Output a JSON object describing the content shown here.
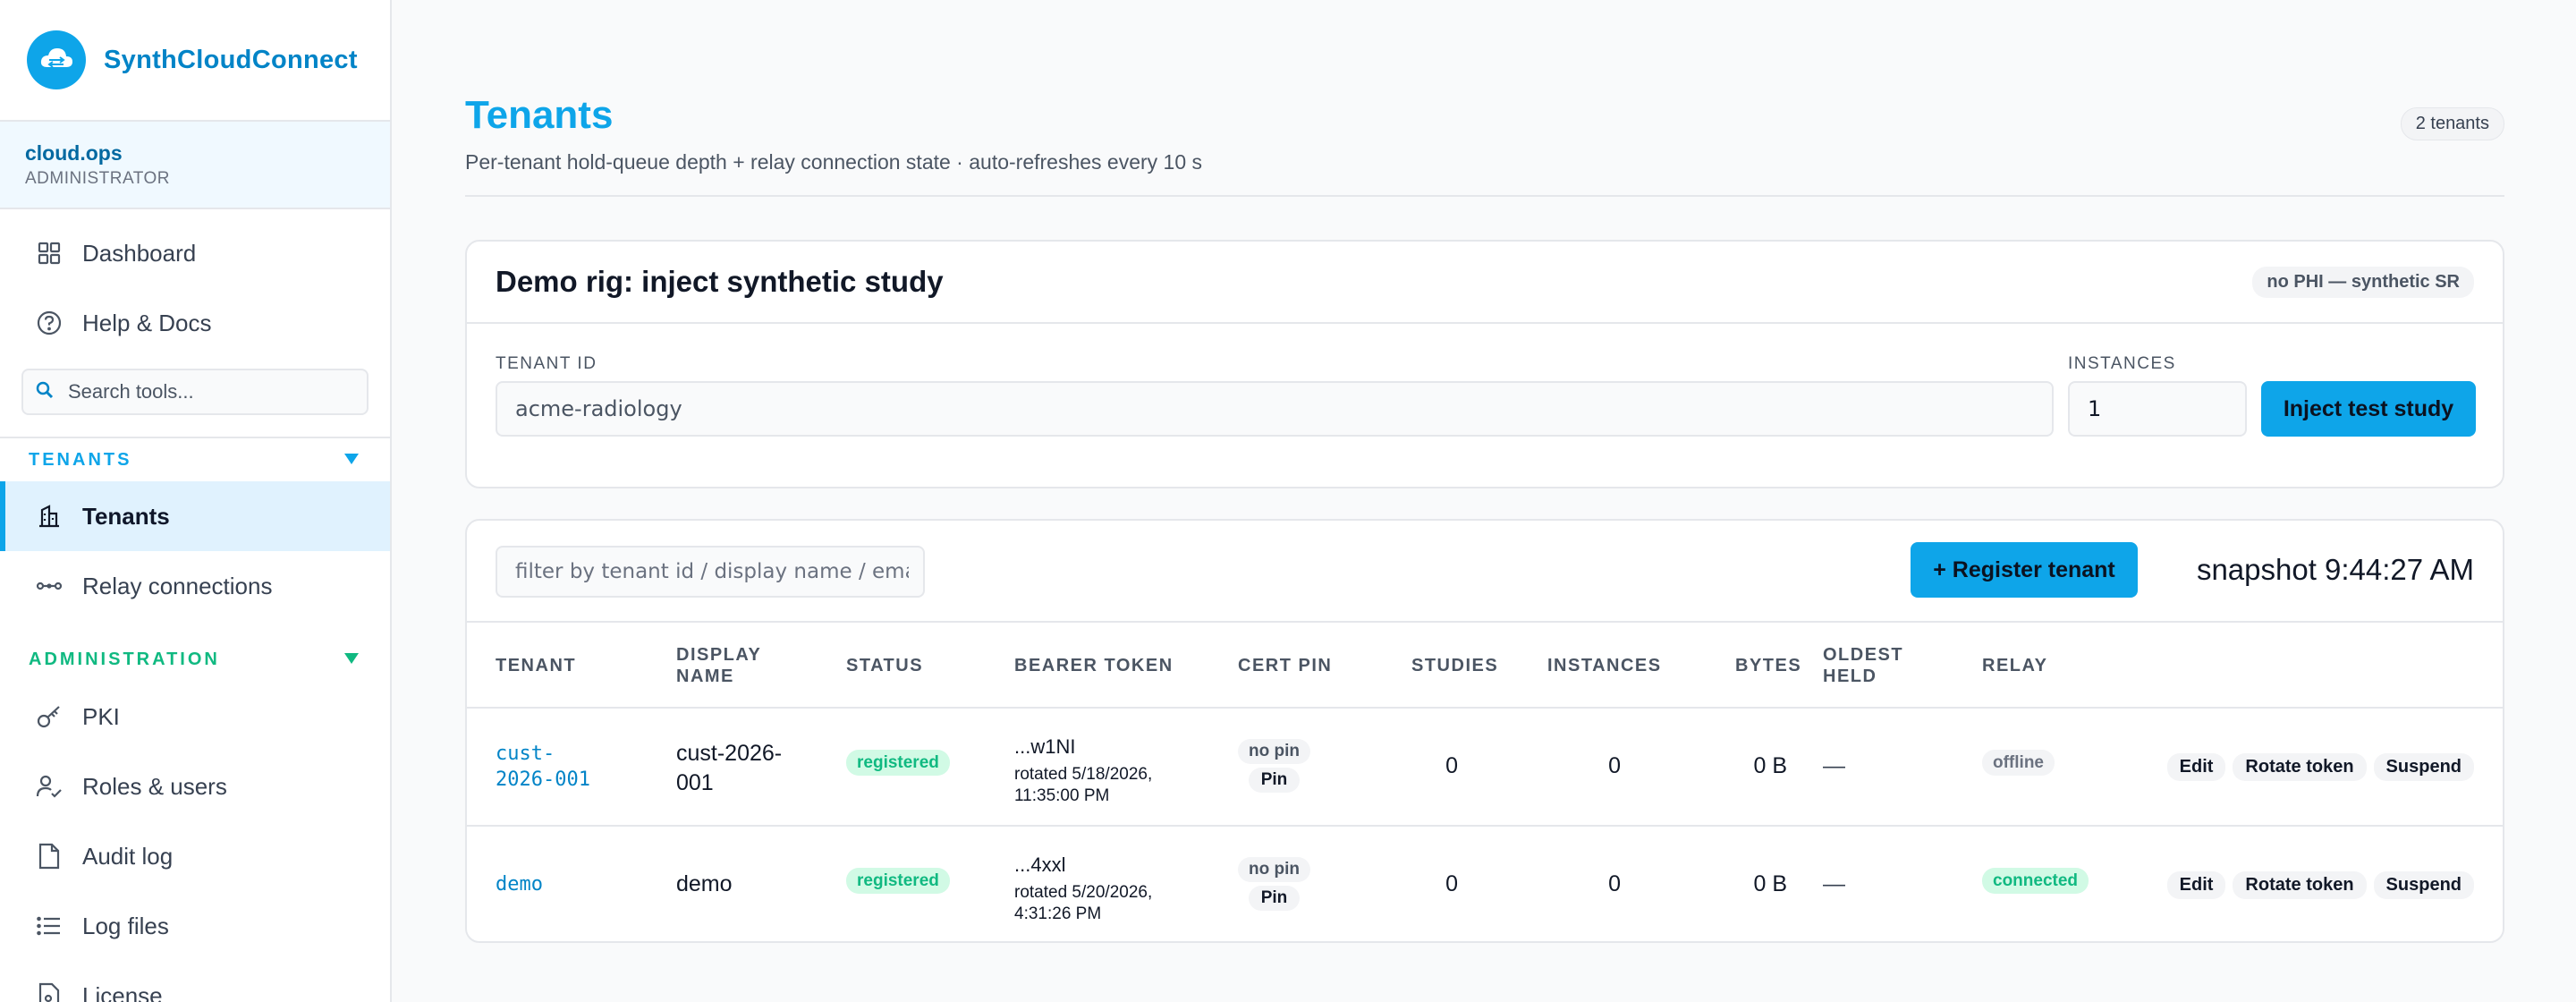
{
  "app": {
    "name": "SynthCloudConnect"
  },
  "user": {
    "name": "cloud.ops",
    "role": "ADMINISTRATOR"
  },
  "sidebar": {
    "top_items": [
      {
        "label": "Dashboard",
        "icon": "grid-icon"
      },
      {
        "label": "Help & Docs",
        "icon": "help-circle-icon"
      }
    ],
    "search_placeholder": "Search tools...",
    "tenants_section": {
      "title": "TENANTS",
      "items": [
        {
          "label": "Tenants",
          "icon": "building-icon",
          "active": true
        },
        {
          "label": "Relay connections",
          "icon": "relay-icon"
        }
      ]
    },
    "admin_section": {
      "title": "ADMINISTRATION",
      "items": [
        {
          "label": "PKI",
          "icon": "key-icon"
        },
        {
          "label": "Roles & users",
          "icon": "user-check-icon"
        },
        {
          "label": "Audit log",
          "icon": "document-icon"
        },
        {
          "label": "Log files",
          "icon": "list-icon"
        },
        {
          "label": "License",
          "icon": "license-icon"
        }
      ]
    },
    "colors": {
      "tenants_accent": "#0ea5e9",
      "admin_accent": "#10b981"
    }
  },
  "page": {
    "title": "Tenants",
    "subtitle": "Per-tenant hold-queue depth + relay connection state · auto-refreshes every 10 s",
    "count_badge": "2 tenants"
  },
  "demo_rig": {
    "title": "Demo rig: inject synthetic study",
    "badge": "no PHI — synthetic SR",
    "tenant_label": "TENANT ID",
    "tenant_value": "acme-radiology",
    "instances_label": "INSTANCES",
    "instances_value": "1",
    "inject_button": "Inject test study"
  },
  "tenants_table": {
    "filter_placeholder": "filter by tenant id / display name / email...",
    "register_button": "+ Register tenant",
    "snapshot": "snapshot 9:44:27 AM",
    "headers": {
      "tenant": "TENANT",
      "display_name": [
        "DISPLAY",
        "NAME"
      ],
      "status": "STATUS",
      "bearer_token": "BEARER TOKEN",
      "cert_pin": "CERT PIN",
      "studies": "STUDIES",
      "instances": "INSTANCES",
      "bytes": "BYTES",
      "oldest_held": [
        "OLDEST",
        "HELD"
      ],
      "relay": "RELAY"
    },
    "rows": [
      {
        "tenant_id": [
          "cust-",
          "2026-001"
        ],
        "display_name": [
          "cust-2026-",
          "001"
        ],
        "status": "registered",
        "token": "...w1NI",
        "rotated": [
          "rotated 5/18/2026,",
          "11:35:00 PM"
        ],
        "pin_status": "no pin",
        "pin_button": "Pin",
        "studies": "0",
        "instances": "0",
        "bytes": "0 B",
        "oldest_held": "—",
        "relay": "offline",
        "actions": [
          "Edit",
          "Rotate token",
          "Suspend"
        ]
      },
      {
        "tenant_id": [
          "demo"
        ],
        "display_name": [
          "demo"
        ],
        "status": "registered",
        "token": "...4xxl",
        "rotated": [
          "rotated 5/20/2026,",
          "4:31:26 PM"
        ],
        "pin_status": "no pin",
        "pin_button": "Pin",
        "studies": "0",
        "instances": "0",
        "bytes": "0 B",
        "oldest_held": "—",
        "relay": "connected",
        "actions": [
          "Edit",
          "Rotate token",
          "Suspend"
        ]
      }
    ]
  }
}
